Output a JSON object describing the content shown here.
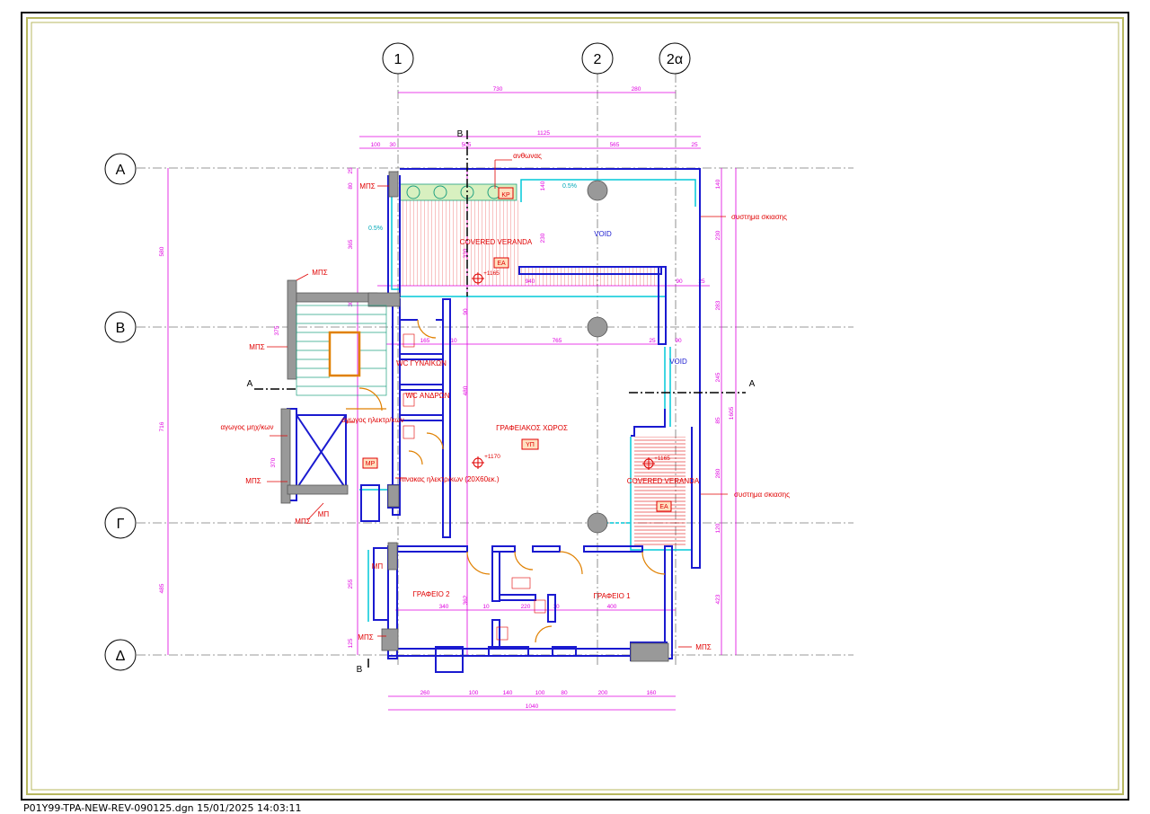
{
  "footer": {
    "filename": "P01Y99-TPA-NEW-REV-090125.dgn 15/01/2025 14:03:11"
  },
  "grid": {
    "columns": [
      "1",
      "2",
      "2α"
    ],
    "rows": [
      "Α",
      "Β",
      "Γ",
      "Δ"
    ]
  },
  "dims": {
    "top1": [
      "730",
      "280"
    ],
    "top2": "1125",
    "top3": [
      "100",
      "30",
      "505",
      "565",
      "25"
    ],
    "bottom1": [
      "260",
      "100",
      "140",
      "100",
      "80",
      "200",
      "160"
    ],
    "bottom2": "1040",
    "left_overall": "580",
    "left_overall2": "716",
    "left_overall3": "485",
    "right_total": "1605",
    "right_chain": [
      "140",
      "230",
      "283",
      "245",
      "85",
      "280",
      "120",
      "423"
    ],
    "left_chain": [
      "25",
      "80",
      "365",
      "30",
      "375",
      "370",
      "255",
      "125"
    ],
    "inner": [
      "140",
      "230",
      "90",
      "480",
      "330",
      "362",
      "940",
      "90",
      "25",
      "165",
      "10",
      "765",
      "25",
      "90",
      "340",
      "400",
      "220",
      "10",
      "10"
    ]
  },
  "labels": {
    "anthonas": "ανθωνας",
    "kr": "ΚΡ",
    "slope1": "0.5%",
    "slope2": "0.5%",
    "covered_veranda_top": "COVERED VERANDA",
    "ea_top": "ΕΑ",
    "void_top": "VOID",
    "void_right": "VOID",
    "shade1": "συστημα σκιασης",
    "shade2": "συστημα σκιασης",
    "level1": "+1165",
    "level2": "+1170",
    "level3": "+1165",
    "mps1": "ΜΠΣ",
    "mps2": "ΜΠΣ",
    "mps3": "ΜΠΣ",
    "mps4": "ΜΠΣ",
    "mps5": "ΜΠΣ",
    "mps6": "ΜΠΣ",
    "mps7": "ΜΠΣ",
    "mp1": "ΜΠ",
    "mp2": "ΜΠ",
    "mp_box": "ΜΡ",
    "wc_women": "WC ΓΥΝΑΙΚΩΝ",
    "wc_men": "WC ΑΝΔΡΩΝ",
    "office_space": "ΓΡΑΦΕΙΑΚΟΣ ΧΩΡΟΣ",
    "yp": "ΥΠ",
    "duct_mech": "αγωγος μηχ/κων",
    "duct_elec": "αγωγος ηλεκτρ/κων",
    "panel": "πινακας ηλεκτρ/κων (20Χ60εκ.)",
    "covered_veranda_right": "COVERED VERANDA",
    "ea_right": "ΕΑ",
    "office2": "ΓΡΑΦΕΙΟ 2",
    "office1": "ΓΡΑΦΕΙΟ 1",
    "section_a": "Α",
    "section_a2": "Α",
    "section_b": "Β",
    "section_b2": "Β"
  },
  "colors": {
    "wall": "#1a1ad0",
    "cyan": "#00c8d8",
    "magenta": "#e000e0",
    "red": "#e00000",
    "green": "#20a080",
    "gray": "#999999",
    "orange": "#e08000",
    "border_yellow": "#b8b860"
  }
}
